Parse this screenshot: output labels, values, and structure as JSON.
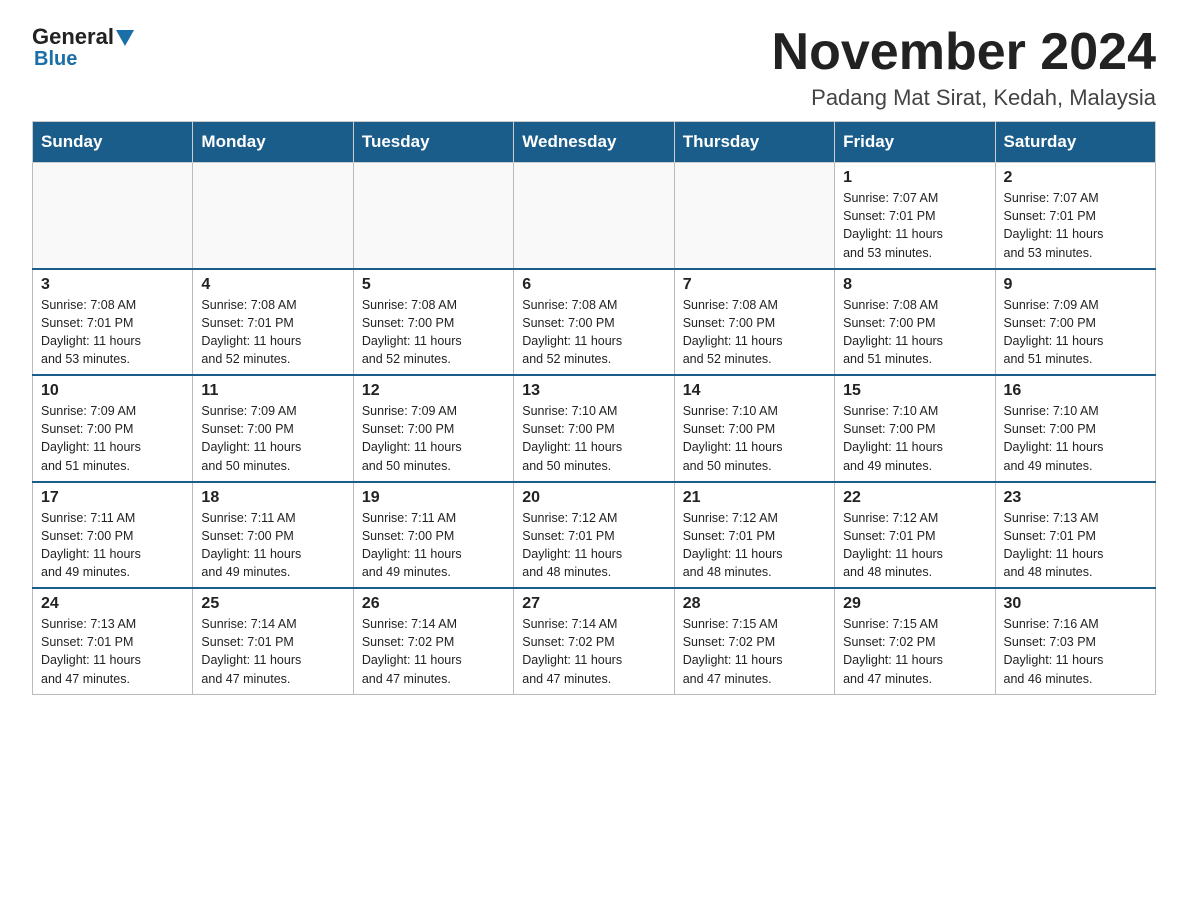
{
  "header": {
    "logo_general": "General",
    "logo_blue": "Blue",
    "main_title": "November 2024",
    "sub_title": "Padang Mat Sirat, Kedah, Malaysia"
  },
  "calendar": {
    "weekdays": [
      "Sunday",
      "Monday",
      "Tuesday",
      "Wednesday",
      "Thursday",
      "Friday",
      "Saturday"
    ],
    "rows": [
      [
        {
          "day": "",
          "info": ""
        },
        {
          "day": "",
          "info": ""
        },
        {
          "day": "",
          "info": ""
        },
        {
          "day": "",
          "info": ""
        },
        {
          "day": "",
          "info": ""
        },
        {
          "day": "1",
          "info": "Sunrise: 7:07 AM\nSunset: 7:01 PM\nDaylight: 11 hours\nand 53 minutes."
        },
        {
          "day": "2",
          "info": "Sunrise: 7:07 AM\nSunset: 7:01 PM\nDaylight: 11 hours\nand 53 minutes."
        }
      ],
      [
        {
          "day": "3",
          "info": "Sunrise: 7:08 AM\nSunset: 7:01 PM\nDaylight: 11 hours\nand 53 minutes."
        },
        {
          "day": "4",
          "info": "Sunrise: 7:08 AM\nSunset: 7:01 PM\nDaylight: 11 hours\nand 52 minutes."
        },
        {
          "day": "5",
          "info": "Sunrise: 7:08 AM\nSunset: 7:00 PM\nDaylight: 11 hours\nand 52 minutes."
        },
        {
          "day": "6",
          "info": "Sunrise: 7:08 AM\nSunset: 7:00 PM\nDaylight: 11 hours\nand 52 minutes."
        },
        {
          "day": "7",
          "info": "Sunrise: 7:08 AM\nSunset: 7:00 PM\nDaylight: 11 hours\nand 52 minutes."
        },
        {
          "day": "8",
          "info": "Sunrise: 7:08 AM\nSunset: 7:00 PM\nDaylight: 11 hours\nand 51 minutes."
        },
        {
          "day": "9",
          "info": "Sunrise: 7:09 AM\nSunset: 7:00 PM\nDaylight: 11 hours\nand 51 minutes."
        }
      ],
      [
        {
          "day": "10",
          "info": "Sunrise: 7:09 AM\nSunset: 7:00 PM\nDaylight: 11 hours\nand 51 minutes."
        },
        {
          "day": "11",
          "info": "Sunrise: 7:09 AM\nSunset: 7:00 PM\nDaylight: 11 hours\nand 50 minutes."
        },
        {
          "day": "12",
          "info": "Sunrise: 7:09 AM\nSunset: 7:00 PM\nDaylight: 11 hours\nand 50 minutes."
        },
        {
          "day": "13",
          "info": "Sunrise: 7:10 AM\nSunset: 7:00 PM\nDaylight: 11 hours\nand 50 minutes."
        },
        {
          "day": "14",
          "info": "Sunrise: 7:10 AM\nSunset: 7:00 PM\nDaylight: 11 hours\nand 50 minutes."
        },
        {
          "day": "15",
          "info": "Sunrise: 7:10 AM\nSunset: 7:00 PM\nDaylight: 11 hours\nand 49 minutes."
        },
        {
          "day": "16",
          "info": "Sunrise: 7:10 AM\nSunset: 7:00 PM\nDaylight: 11 hours\nand 49 minutes."
        }
      ],
      [
        {
          "day": "17",
          "info": "Sunrise: 7:11 AM\nSunset: 7:00 PM\nDaylight: 11 hours\nand 49 minutes."
        },
        {
          "day": "18",
          "info": "Sunrise: 7:11 AM\nSunset: 7:00 PM\nDaylight: 11 hours\nand 49 minutes."
        },
        {
          "day": "19",
          "info": "Sunrise: 7:11 AM\nSunset: 7:00 PM\nDaylight: 11 hours\nand 49 minutes."
        },
        {
          "day": "20",
          "info": "Sunrise: 7:12 AM\nSunset: 7:01 PM\nDaylight: 11 hours\nand 48 minutes."
        },
        {
          "day": "21",
          "info": "Sunrise: 7:12 AM\nSunset: 7:01 PM\nDaylight: 11 hours\nand 48 minutes."
        },
        {
          "day": "22",
          "info": "Sunrise: 7:12 AM\nSunset: 7:01 PM\nDaylight: 11 hours\nand 48 minutes."
        },
        {
          "day": "23",
          "info": "Sunrise: 7:13 AM\nSunset: 7:01 PM\nDaylight: 11 hours\nand 48 minutes."
        }
      ],
      [
        {
          "day": "24",
          "info": "Sunrise: 7:13 AM\nSunset: 7:01 PM\nDaylight: 11 hours\nand 47 minutes."
        },
        {
          "day": "25",
          "info": "Sunrise: 7:14 AM\nSunset: 7:01 PM\nDaylight: 11 hours\nand 47 minutes."
        },
        {
          "day": "26",
          "info": "Sunrise: 7:14 AM\nSunset: 7:02 PM\nDaylight: 11 hours\nand 47 minutes."
        },
        {
          "day": "27",
          "info": "Sunrise: 7:14 AM\nSunset: 7:02 PM\nDaylight: 11 hours\nand 47 minutes."
        },
        {
          "day": "28",
          "info": "Sunrise: 7:15 AM\nSunset: 7:02 PM\nDaylight: 11 hours\nand 47 minutes."
        },
        {
          "day": "29",
          "info": "Sunrise: 7:15 AM\nSunset: 7:02 PM\nDaylight: 11 hours\nand 47 minutes."
        },
        {
          "day": "30",
          "info": "Sunrise: 7:16 AM\nSunset: 7:03 PM\nDaylight: 11 hours\nand 46 minutes."
        }
      ]
    ]
  }
}
